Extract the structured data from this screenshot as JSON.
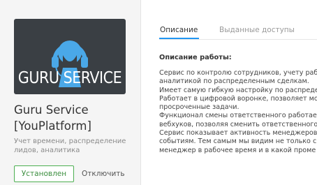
{
  "app": {
    "logo_text": "GURU SERVICE",
    "name": "Guru Service [YouPlatform]",
    "description": "Учет времени, распределение лидов, аналитика",
    "installed_label": "Установлен",
    "disable_label": "Отключить"
  },
  "tabs": [
    {
      "label": "Описание",
      "active": true
    },
    {
      "label": "Выданные доступы",
      "active": false
    }
  ],
  "content": {
    "section_title": "Описание работы:",
    "lines": [
      "Сервис по контролю сотрудников, учету раб",
      "аналитикой по распределенным сделкам.",
      "Имеет самую гибкую настройку по распреде",
      "Работает в цифровой воронке, позволяет мо",
      "просроченные задачи.",
      "Функционал смены ответственного работае",
      "вебхуков, позволяя сменить ответственного",
      "Сервис показывает активность менеджеров",
      "событиям. Тем самым мы видим не только с",
      "менеджер в рабочее время и в какой проме"
    ]
  },
  "colors": {
    "accent_blue": "#2196f3",
    "logo_background": "#3a3f44",
    "logo_icon_blue": "#4aa8e8",
    "installed_green": "#4caf50"
  }
}
